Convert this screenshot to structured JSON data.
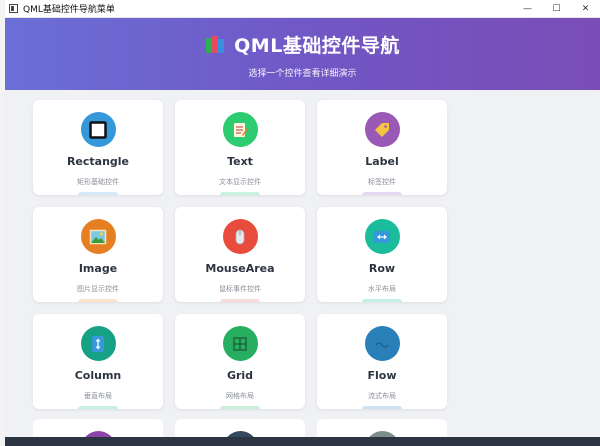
{
  "window": {
    "title": "QML基础控件导航菜单",
    "minimize": "—",
    "maximize": "☐",
    "close": "✕"
  },
  "header": {
    "title": "QML基础控件导航",
    "subtitle": "选择一个控件查看详细演示"
  },
  "cards": [
    {
      "name": "Rectangle",
      "desc": "矩形基础控件",
      "icon": "square-frame-icon",
      "color": "#3498db",
      "bar": "#d6e9fb"
    },
    {
      "name": "Text",
      "desc": "文本显示控件",
      "icon": "memo-icon",
      "color": "#2ecc71",
      "bar": "#c8f3dc"
    },
    {
      "name": "Label",
      "desc": "标签控件",
      "icon": "tag-icon",
      "color": "#9b59b6",
      "bar": "#e8d7f2"
    },
    {
      "name": "Image",
      "desc": "图片显示控件",
      "icon": "picture-icon",
      "color": "#e67e22",
      "bar": "#fbe3cc"
    },
    {
      "name": "MouseArea",
      "desc": "鼠标事件控件",
      "icon": "mouse-icon",
      "color": "#e74c3c",
      "bar": "#f9dcd9"
    },
    {
      "name": "Row",
      "desc": "水平布局",
      "icon": "horizontal-arrows-icon",
      "color": "#1abc9c",
      "bar": "#c5f0e6"
    },
    {
      "name": "Column",
      "desc": "垂直布局",
      "icon": "vertical-arrows-icon",
      "color": "#16a085",
      "bar": "#c7efe3"
    },
    {
      "name": "Grid",
      "desc": "网格布局",
      "icon": "grid-icon",
      "color": "#27ae60",
      "bar": "#caefd8"
    },
    {
      "name": "Flow",
      "desc": "流式布局",
      "icon": "wave-icon",
      "color": "#2980b9",
      "bar": "#cfe2f3"
    }
  ],
  "peek_cards": [
    {
      "color": "#8e44ad"
    },
    {
      "color": "#34495e"
    },
    {
      "color": "#7f8c8d"
    }
  ]
}
